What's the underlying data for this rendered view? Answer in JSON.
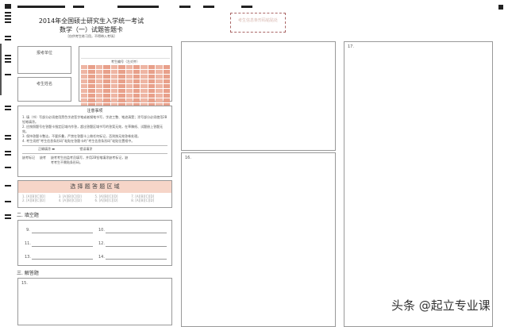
{
  "header": {
    "title": "2014年全国硕士研究生入学统一考试",
    "subtitle": "数学（一）试题答题卡",
    "note": "[仅供考生练习用，不得带入考场]",
    "barcode_label": "考生信息条形码粘贴处"
  },
  "candidate": {
    "exam_site": "报考单位",
    "name": "考生姓名",
    "id_label": "考生编号（左对齐）"
  },
  "notice": {
    "title": "注意事项",
    "items": [
      "1. 填（书）写部分必须使用黑色字迹签字笔或者钢笔书写，字迹工整、笔迹清楚；涂写部分必须使用2B铅笔填涂。",
      "2. 应按照题号在答题卡指定区域内作答，超出答题区域书写的答案无效，在草稿纸、试题册上答题无效。",
      "3. 保持答题卡整洁，不要折叠，严禁在答题卡上做任何标记，否则按无效答卷处理。",
      "4. 考生须把“考生信息条形码”粘贴在答题卡的“考生信息条形码”粘贴位置框中。"
    ],
    "fill_right": "正确填涂",
    "fill_wrong": "错误填涂",
    "absent_label": "缺考标记",
    "absent_box": "缺考",
    "absent_note": "缺考考生由监考员填写，并用2B铅笔填涂缺考标记，缺考考生不需贴条形码。"
  },
  "choice": {
    "title": "选 择 题 答 题 区 域",
    "items": [
      "1",
      "2",
      "3",
      "4",
      "5",
      "6",
      "7",
      "8"
    ]
  },
  "fill": {
    "title": "二. 填空题",
    "items": [
      "9.",
      "10.",
      "11.",
      "12.",
      "13.",
      "14."
    ]
  },
  "essay": {
    "title": "三. 解答题",
    "q15": "15.",
    "q16": "16.",
    "q17": "17."
  },
  "watermark": "头条 @起立专业课"
}
